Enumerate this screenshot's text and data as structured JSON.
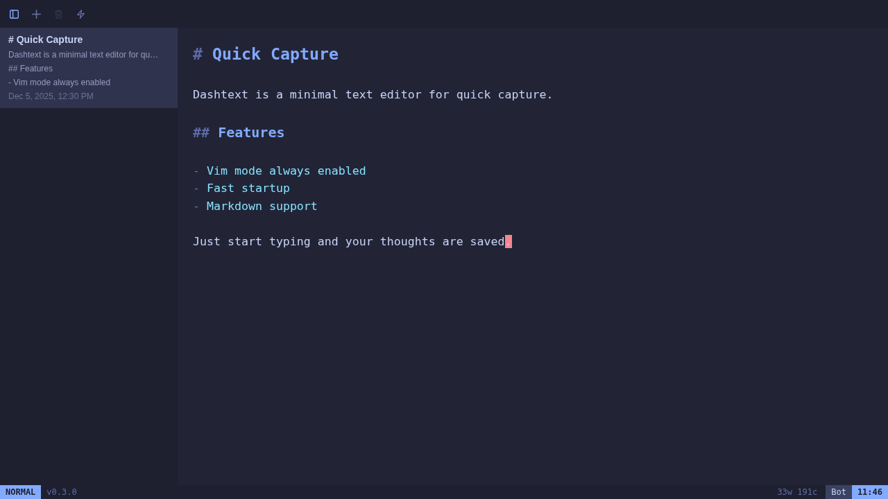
{
  "toolbar": {
    "buttons": [
      {
        "kind": "sidebar",
        "on": true,
        "disabled": false
      },
      {
        "kind": "new",
        "on": false,
        "disabled": false
      },
      {
        "kind": "delete",
        "on": false,
        "disabled": true
      },
      {
        "kind": "lightning",
        "on": false,
        "disabled": false
      }
    ]
  },
  "sidebar": {
    "notes": [
      {
        "title": "# Quick Capture",
        "preview": [
          "Dashtext is a minimal text editor for qu…",
          "## Features",
          "- Vim mode always enabled"
        ],
        "date": "Dec 5, 2025, 12:30 PM",
        "selected": true
      }
    ]
  },
  "editor": {
    "blocks": [
      {
        "kind": "heading1",
        "marker": "#",
        "text": "Quick Capture"
      },
      {
        "kind": "paragraph",
        "text": "Dashtext is a minimal text editor for quick capture."
      },
      {
        "kind": "heading2",
        "marker": "##",
        "text": "Features"
      },
      {
        "kind": "list_item",
        "marker": "-",
        "text": "Vim mode always enabled"
      },
      {
        "kind": "list_item",
        "marker": "-",
        "text": "Fast startup"
      },
      {
        "kind": "list_item",
        "marker": "-",
        "text": "Markdown support"
      },
      {
        "kind": "paragraph",
        "text": "Just start typing and your thoughts are saved",
        "cursor_char": "."
      }
    ]
  },
  "status_bar": {
    "mode": "NORMAL",
    "version": "v0.3.0",
    "counts": "33w 191c",
    "scroll_position": "Bot",
    "time": "11:46"
  }
}
